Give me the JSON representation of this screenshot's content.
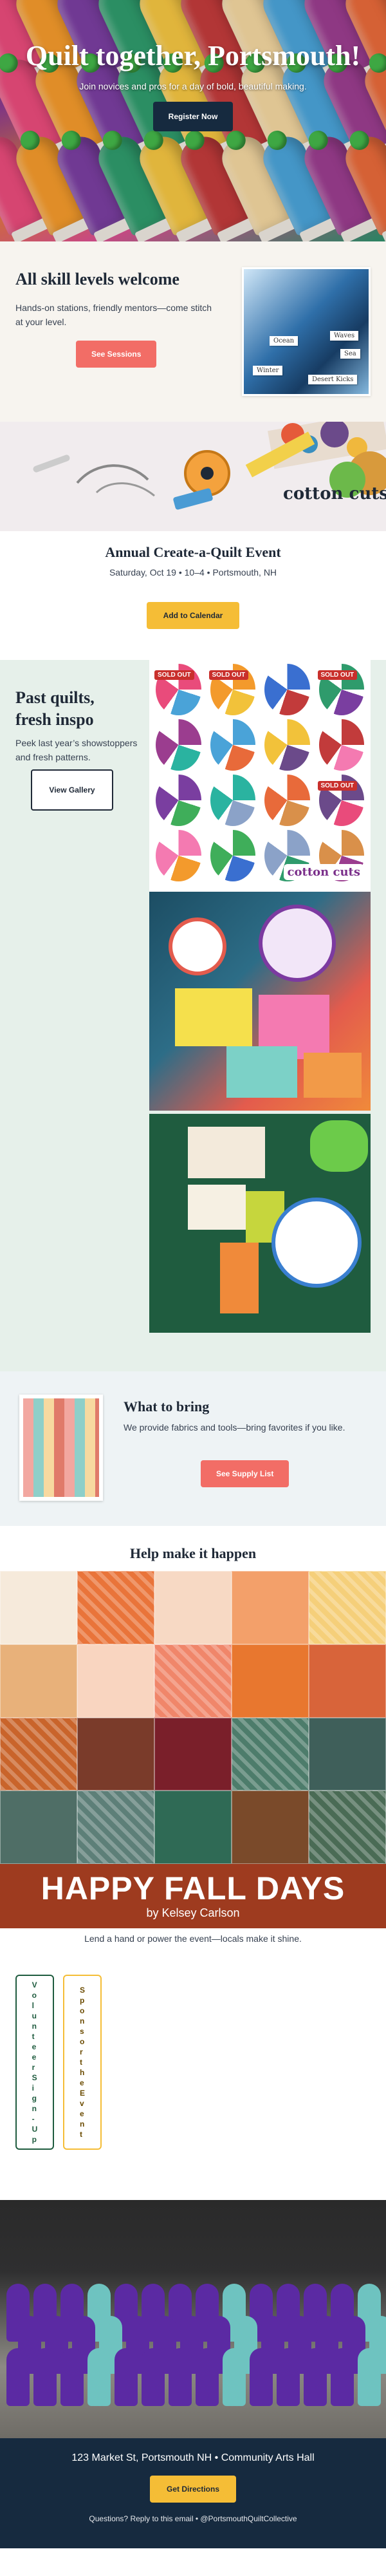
{
  "hero": {
    "title": "Quilt together, Portsmouth!",
    "subtitle": "Join novices and pros for a day of bold, beautiful making.",
    "cta_label": "Register Now"
  },
  "skill": {
    "title": "All skill levels welcome",
    "text": "Hands-on stations, friendly mentors—come stitch at your level.",
    "cta_label": "See Sessions",
    "image_tags": [
      "Ocean",
      "Waves",
      "Sea",
      "Winter",
      "Desert Kicks"
    ]
  },
  "event": {
    "title": "Annual Create-a-Quilt Event",
    "details": "Saturday, Oct 19 • 10–4 • Portsmouth, NH",
    "cta_label": "Add to Calendar"
  },
  "gallery": {
    "title": "Past quilts, fresh inspo",
    "text": "Peek last year’s showstoppers and fresh patterns.",
    "cta_label": "View Gallery",
    "sold_out_label": "SOLD OUT",
    "brand": "cotton cuts"
  },
  "bring": {
    "title": "What to bring",
    "text": "We provide fabrics and tools—bring favorites if you like.",
    "cta_label": "See Supply List"
  },
  "help": {
    "title": "Help make it happen",
    "banner_title": "HAPPY FALL DAYS",
    "banner_by": "by Kelsey Carlson",
    "subtitle": "Lend a hand or power the event—locals make it shine.",
    "volunteer_label": "Volunteer Sign-Up",
    "sponsor_label": "Sponsor the Event"
  },
  "footer": {
    "address": "123 Market St, Portsmouth NH • Community Arts Hall",
    "cta_label": "Get Directions",
    "contact": "Questions? Reply to this email • @PortsmouthQuiltCollective"
  },
  "colors": {
    "navy": "#162a3f",
    "coral": "#f26d66",
    "gold": "#f5bd36",
    "sage_bg": "#e6f0ea",
    "cream_bg": "#f7f4ef",
    "rust": "#9e3b1f"
  }
}
